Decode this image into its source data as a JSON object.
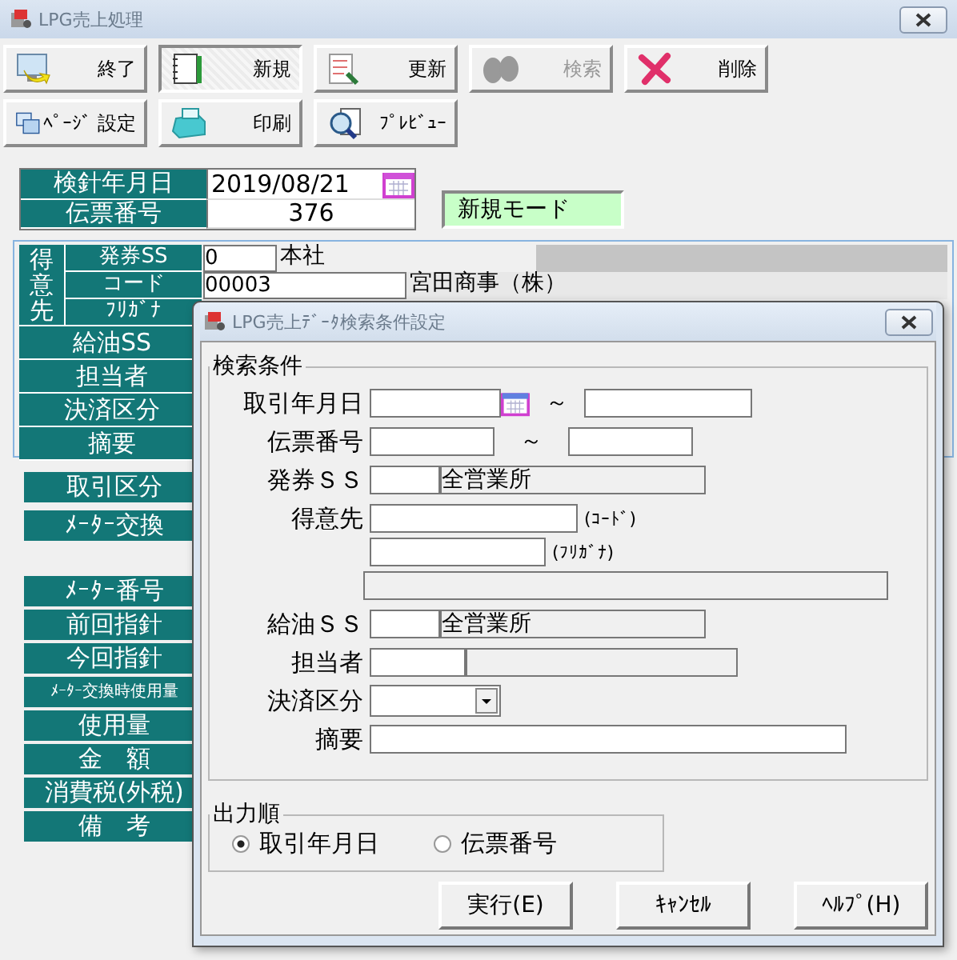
{
  "window": {
    "title": "LPG売上処理"
  },
  "toolbar_rows": [
    [
      {
        "label": "終了",
        "disabled": false,
        "pressed": false
      },
      {
        "label": "新規",
        "disabled": false,
        "pressed": true
      },
      {
        "label": "更新",
        "disabled": false,
        "pressed": false
      },
      {
        "label": "検索",
        "disabled": true,
        "pressed": false
      },
      {
        "label": "削除",
        "disabled": false,
        "pressed": false
      }
    ],
    [
      {
        "label": "ﾍﾟｰｼﾞ 設定",
        "disabled": false,
        "pressed": false
      },
      {
        "label": "印刷",
        "disabled": false,
        "pressed": false
      },
      {
        "label": "ﾌﾟﾚﾋﾞｭｰ",
        "disabled": false,
        "pressed": false
      }
    ]
  ],
  "slip": {
    "rows": [
      {
        "label": "検針年月日",
        "value": "2019/08/21",
        "kind": "date"
      },
      {
        "label": "伝票番号",
        "value": "376",
        "kind": "number"
      }
    ],
    "mode": "新規モード"
  },
  "customer": {
    "label": "得意先",
    "rows": [
      {
        "label": "発券SS",
        "code": "0",
        "name": "本社"
      },
      {
        "label": "コード",
        "code": "00003",
        "name": "宮田商事（株）"
      },
      {
        "label": "ﾌﾘｶﾞﾅ"
      }
    ]
  },
  "panel_labels": [
    "給油SS",
    "担当者",
    "決済区分",
    "摘要"
  ],
  "label_groups": [
    [
      "取引区分",
      "ﾒｰﾀｰ交換"
    ],
    [
      "ﾒｰﾀｰ番号",
      "前回指針",
      "今回指針",
      "ﾒｰﾀｰ交換時使用量",
      "使用量",
      "金　額",
      "消費税(外税)",
      "備　考"
    ]
  ],
  "dialog": {
    "title": "LPG売上ﾃﾞｰﾀ検索条件設定",
    "criteria": {
      "title": "検索条件",
      "rows": [
        {
          "kind": "date_range",
          "label": "取引年月日",
          "separator": "～"
        },
        {
          "kind": "range",
          "label": "伝票番号",
          "separator": "～"
        },
        {
          "kind": "code_name",
          "label": "発券ＳＳ",
          "name": "全営業所"
        },
        {
          "kind": "customer",
          "label": "得意先",
          "code_hint": "(ｺｰﾄﾞ)",
          "kana_hint": "(ﾌﾘｶﾞﾅ)"
        },
        {
          "kind": "code_name",
          "label": "給油ＳＳ",
          "name": "全営業所"
        },
        {
          "kind": "staff",
          "label": "担当者"
        },
        {
          "kind": "select",
          "label": "決済区分"
        },
        {
          "kind": "text",
          "label": "摘要"
        }
      ]
    },
    "order": {
      "title": "出力順",
      "options": [
        {
          "label": "取引年月日",
          "selected": true
        },
        {
          "label": "伝票番号",
          "selected": false
        }
      ]
    },
    "buttons": [
      "実行(E)",
      "ｷｬﾝｾﾙ",
      "ﾍﾙﾌﾟ(H)"
    ]
  }
}
